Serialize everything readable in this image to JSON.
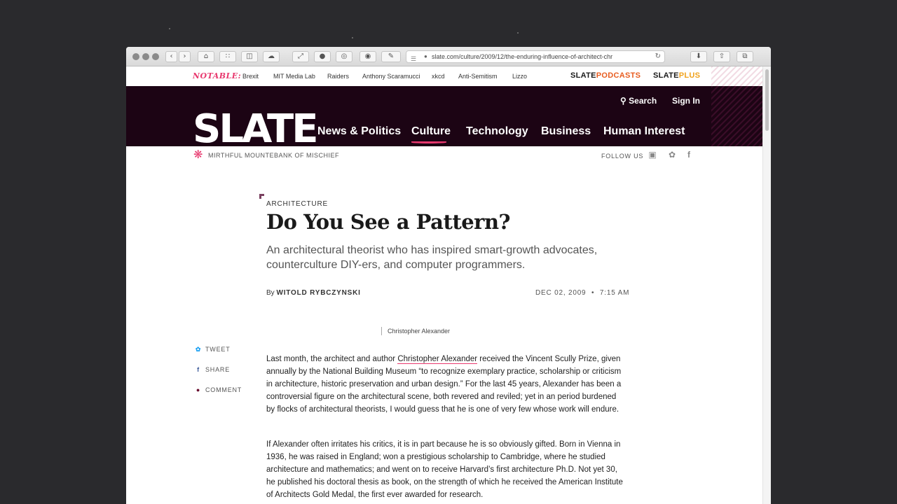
{
  "browser": {
    "url": "slate.com/culture/2009/12/the-enduring-influence-of-architect-chr",
    "new_tab": "+"
  },
  "notable": {
    "label": "NOTABLE:",
    "links": [
      "Brexit",
      "MIT Media Lab",
      "Raiders",
      "Anthony Scaramucci",
      "xkcd",
      "Anti-Semitism",
      "Lizzo"
    ],
    "podcasts_prefix": "SLATE",
    "podcasts_suffix": "PODCASTS",
    "plus_prefix": "SLATE",
    "plus_suffix": "PLUS"
  },
  "header": {
    "logo": "SLATE",
    "search": "Search",
    "sign_in": "Sign In",
    "nav": [
      "News & Politics",
      "Culture",
      "Technology",
      "Business",
      "Human Interest"
    ],
    "tagline": "MIRTHFUL MOUNTEBANK OF MISCHIEF",
    "follow": "FOLLOW US"
  },
  "article": {
    "section": "ARCHITECTURE",
    "headline": "Do You See a Pattern?",
    "dek": "An architectural theorist who has inspired smart-growth advocates, counterculture DIY-ers, and computer programmers.",
    "byline_prefix": "By",
    "author": "WITOLD RYBCZYNSKI",
    "date": "DEC 02, 2009",
    "time": "7:15 AM",
    "caption": "Christopher Alexander",
    "p1_a": "Last month, the architect and author ",
    "p1_link": "Christopher Alexander",
    "p1_b": " received the Vincent Scully Prize, given annually by the National Building Museum “to recognize exemplary practice, scholarship or criticism in architecture, historic preservation and urban design.” For the last 45 years, Alexander has been a controversial figure on the architectural scene, both revered and reviled; yet in an period burdened by flocks of architectural theorists, I would guess that he is one of very few whose work will endure.",
    "p2": "If Alexander often irritates his critics, it is in part because he is so obviously gifted. Born in Vienna in 1936, he was raised in England; won a prestigious scholarship to Cambridge, where he studied architecture and mathematics; and went on to receive Harvard’s first architecture Ph.D. Not yet 30, he published his doctoral thesis as book, on the strength of which he received the American Institute of Architects Gold Medal, the first ever awarded for research."
  },
  "share": {
    "tweet": "TWEET",
    "share": "SHARE",
    "comment": "COMMENT"
  },
  "colors": {
    "accent": "#e8386e",
    "masthead": "#1c0414",
    "podcasts": "#e85d20",
    "plus": "#f0a21c"
  }
}
